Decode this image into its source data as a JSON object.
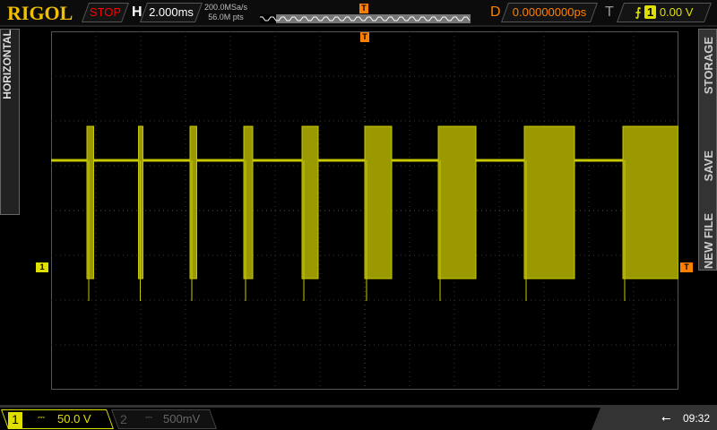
{
  "header": {
    "brand": "RIGOL",
    "run_status": "STOP",
    "horizontal_label": "H",
    "timebase": "2.000ms",
    "sample_rate": "200.0MSa/s",
    "memory_depth": "56.0M pts",
    "delay_label": "D",
    "delay_value": "0.00000000ps",
    "trigger_label": "T",
    "trigger_channel": "1",
    "trigger_level": "0.00 V"
  },
  "side_menu": {
    "left_tab": "HORIZONTAL",
    "storage": "STORAGE",
    "save": "SAVE",
    "new_file": "NEW FILE"
  },
  "markers": {
    "trigger_pos": "T",
    "ch1_ground": "1",
    "trigger_level": "T"
  },
  "footer": {
    "ch1_number": "1",
    "ch1_coupling": "⎓",
    "ch1_scale": "50.0 V",
    "ch2_number": "2",
    "ch2_coupling": "⎓",
    "ch2_scale": "500mV",
    "time": "09:32"
  },
  "colors": {
    "ch1": "#e0e000",
    "trace": "#c8c800",
    "trigger": "#ff8000",
    "stop": "#ff0000"
  },
  "chart_data": {
    "type": "line",
    "title": "CH1 waveform",
    "x_unit": "ms",
    "xlim": [
      -14,
      14
    ],
    "x_per_div": 2,
    "y_unit": "V",
    "ylim": [
      -126,
      274
    ],
    "y_per_div": 50,
    "idle_level": 130,
    "burst_high": 168,
    "burst_low": -2,
    "bursts_ms": [
      [
        -12.4,
        -12.1
      ],
      [
        -10.1,
        -9.9
      ],
      [
        -7.8,
        -7.5
      ],
      [
        -5.4,
        -5.0
      ],
      [
        -2.8,
        -2.08
      ],
      [
        0,
        1.2
      ],
      [
        3.28,
        4.96
      ],
      [
        7.12,
        9.36
      ],
      [
        11.52,
        14
      ]
    ]
  }
}
